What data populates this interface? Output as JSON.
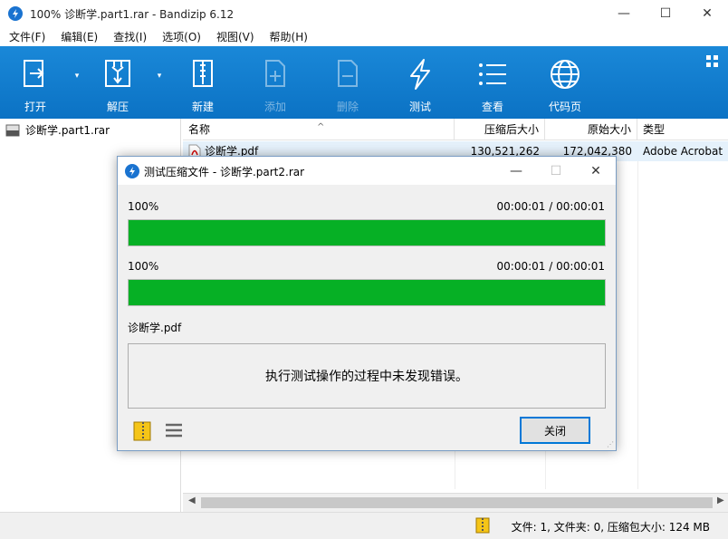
{
  "window": {
    "title": "100% 诊断学.part1.rar - Bandizip 6.12",
    "minimize": "—",
    "maximize": "☐",
    "close": "✕"
  },
  "menu": [
    "文件(F)",
    "编辑(E)",
    "查找(I)",
    "选项(O)",
    "视图(V)",
    "帮助(H)"
  ],
  "toolbar": {
    "open": "打开",
    "extract": "解压",
    "new": "新建",
    "add": "添加",
    "delete": "删除",
    "test": "测试",
    "view": "查看",
    "codepage": "代码页"
  },
  "tree": {
    "archive": "诊断学.part1.rar"
  },
  "columns": {
    "name": "名称",
    "compressed": "压缩后大小",
    "original": "原始大小",
    "type": "类型"
  },
  "files": [
    {
      "name": "诊断学.pdf",
      "compressed": "130,521,262",
      "original": "172,042,380",
      "type": "Adobe Acrobat"
    }
  ],
  "status": {
    "text": "文件: 1, 文件夹: 0, 压缩包大小: 124 MB"
  },
  "dialog": {
    "title": "测试压缩文件 - 诊断学.part2.rar",
    "progress1": {
      "label": "100%",
      "time": "00:00:01 / 00:00:01",
      "percent": 100
    },
    "progress2": {
      "label": "100%",
      "time": "00:00:01 / 00:00:01",
      "percent": 100
    },
    "current_file": "诊断学.pdf",
    "message": "执行测试操作的过程中未发现错误。",
    "close_label": "关闭",
    "minimize": "—",
    "maximize": "☐",
    "close": "✕"
  },
  "colors": {
    "toolbar": "#0b72c4",
    "progress": "#06b025",
    "accent": "#0078d7"
  }
}
